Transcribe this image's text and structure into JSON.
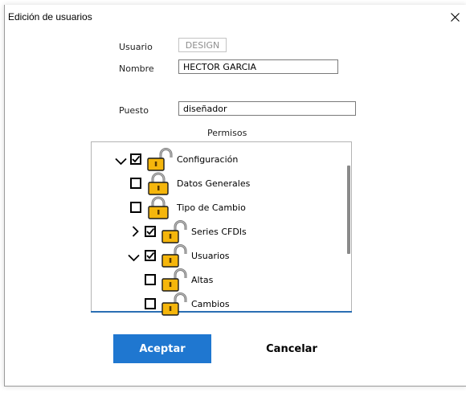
{
  "window": {
    "title": "Edición de usuarios"
  },
  "form": {
    "usuario_label": "Usuario",
    "usuario_value": "DESIGN",
    "nombre_label": "Nombre",
    "nombre_value": "HECTOR GARCIA",
    "puesto_label": "Puesto",
    "puesto_value": "diseñador",
    "permisos_label": "Permisos"
  },
  "tree": {
    "nodes": [
      {
        "label": "Configuración",
        "checked": true,
        "expander": "expanded",
        "lock": "open"
      },
      {
        "label": "Datos Generales",
        "checked": false,
        "expander": "none",
        "lock": "closed"
      },
      {
        "label": "Tipo de Cambio",
        "checked": false,
        "expander": "none",
        "lock": "closed"
      },
      {
        "label": "Series CFDIs",
        "checked": true,
        "expander": "collapsed",
        "lock": "open"
      },
      {
        "label": "Usuarios",
        "checked": true,
        "expander": "expanded",
        "lock": "open"
      },
      {
        "label": "Altas",
        "checked": false,
        "expander": "none",
        "lock": "open"
      },
      {
        "label": "Cambios",
        "checked": false,
        "expander": "none",
        "lock": "open"
      }
    ]
  },
  "buttons": {
    "accept_label": "Aceptar",
    "cancel_label": "Cancelar"
  },
  "colors": {
    "primary": "#1f77d0",
    "lock_body": "#f5b60c",
    "tree_focus_line": "#2b6fb3"
  },
  "icons": {
    "close": "close-icon",
    "expander_open": "chevron-down-icon",
    "expander_closed": "chevron-right-icon",
    "lock_open": "lock-open-icon",
    "lock_closed": "lock-closed-icon",
    "check": "checkmark-icon"
  }
}
